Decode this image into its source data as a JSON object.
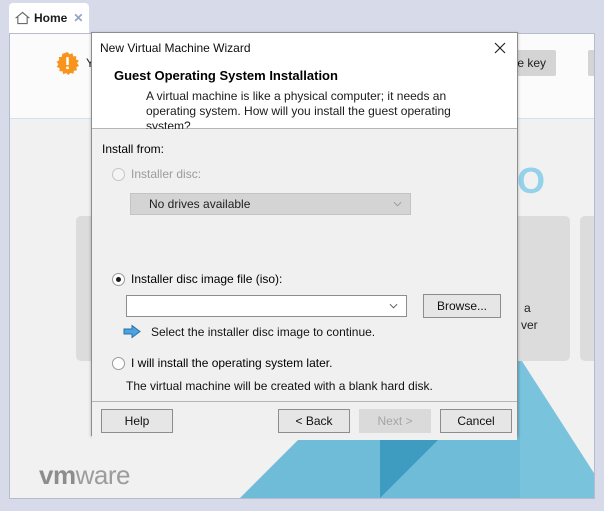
{
  "tab_bar": {
    "tabs": [
      {
        "label": "Home",
        "icon": "home-icon",
        "close_label": "✕"
      }
    ]
  },
  "background": {
    "banner": {
      "warning_icon": "warning-burst-icon",
      "text": "Y",
      "license_button_label": "ense key"
    },
    "pro_text": "PRO",
    "cards": [
      {
        "line1": "a",
        "line2": "ver"
      },
      {
        "line1": "\\"
      }
    ],
    "logo": {
      "bold": "vm",
      "light": "ware"
    },
    "accent_colors": {
      "triangle_light": "#6fbcd8",
      "triangle_dark": "#3e9cc0",
      "pro_blue": "#93d2ea"
    }
  },
  "dialog": {
    "title": "New Virtual Machine Wizard",
    "close_label": "✕",
    "header_title": "Guest Operating System Installation",
    "header_subtitle": "A virtual machine is like a physical computer; it needs an operating system. How will you install the guest operating system?",
    "install_from_label": "Install from:",
    "options": [
      {
        "id": "installer-disc",
        "label": "Installer disc:",
        "checked": false,
        "disabled": true,
        "combo_value": "No drives available"
      },
      {
        "id": "installer-iso",
        "label": "Installer disc image file (iso):",
        "checked": true,
        "disabled": false,
        "combo_value": "",
        "browse_label": "Browse...",
        "hint_icon": "blue-arrow-icon",
        "hint_text": "Select the installer disc image to continue."
      },
      {
        "id": "install-later",
        "label": "I will install the operating system later.",
        "checked": false,
        "disabled": false,
        "note": "The virtual machine will be created with a blank hard disk."
      }
    ],
    "buttons": {
      "help": "Help",
      "back": "< Back",
      "next": "Next >",
      "cancel": "Cancel"
    }
  }
}
